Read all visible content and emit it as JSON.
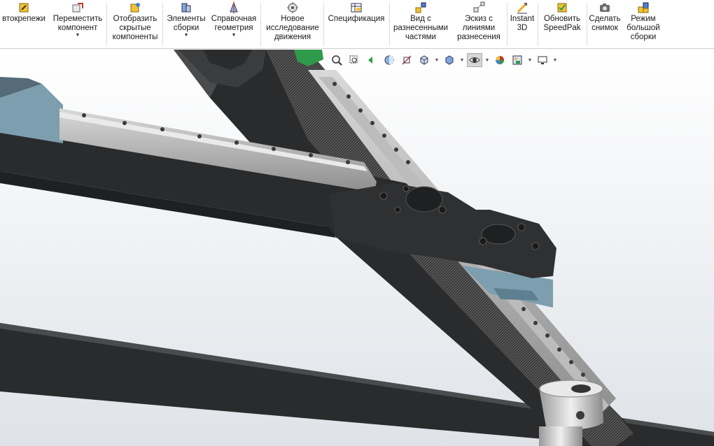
{
  "ribbon": {
    "items": [
      {
        "id": "fasteners",
        "label": "втокрепежи",
        "icon": "fasteners-icon",
        "caret": false
      },
      {
        "id": "move-component",
        "label": "Переместить\nкомпонент",
        "icon": "move-component-icon",
        "caret": true
      },
      {
        "id": "show-hidden",
        "label": "Отобразить\nскрытые\nкомпоненты",
        "icon": "show-hidden-components-icon",
        "caret": false
      },
      {
        "id": "assembly-features",
        "label": "Элементы\nсборки",
        "icon": "assembly-features-icon",
        "caret": true
      },
      {
        "id": "reference-geometry",
        "label": "Справочная\nгеометрия",
        "icon": "reference-geometry-icon",
        "caret": true
      },
      {
        "id": "new-motion-study",
        "label": "Новое\nисследование\nдвижения",
        "icon": "motion-study-icon",
        "caret": false
      },
      {
        "id": "bom",
        "label": "Спецификация",
        "icon": "bill-of-materials-icon",
        "caret": false
      },
      {
        "id": "exploded-view",
        "label": "Вид с\nразнесенными\nчастями",
        "icon": "exploded-view-icon",
        "caret": false
      },
      {
        "id": "explode-line-sketch",
        "label": "Эскиз с\nлиниями\nразнесения",
        "icon": "explode-line-sketch-icon",
        "caret": false
      },
      {
        "id": "instant3d",
        "label": "Instant\n3D",
        "icon": "instant3d-icon",
        "caret": false
      },
      {
        "id": "update-speedpak",
        "label": "Обновить\nSpeedPak",
        "icon": "speedpak-icon",
        "caret": false
      },
      {
        "id": "take-snapshot",
        "label": "Сделать\nснимок",
        "icon": "camera-icon",
        "caret": false
      },
      {
        "id": "large-assembly",
        "label": "Режим\nбольшой\nсборки",
        "icon": "large-assembly-mode-icon",
        "caret": false
      }
    ]
  },
  "heads_up_toolbar": {
    "items": [
      {
        "id": "zoom-to-fit",
        "icon": "zoom-to-fit-icon"
      },
      {
        "id": "zoom-area",
        "icon": "zoom-to-area-icon"
      },
      {
        "id": "previous-view",
        "icon": "previous-view-icon"
      },
      {
        "id": "section-view",
        "icon": "section-view-icon"
      },
      {
        "id": "dynamic-annotation",
        "icon": "dynamic-annotation-views-icon"
      },
      {
        "id": "view-orientation",
        "icon": "view-orientation-icon",
        "caret": true
      },
      {
        "id": "display-style",
        "icon": "display-style-icon",
        "caret": true
      },
      {
        "id": "hide-show-items",
        "icon": "hide-show-items-icon",
        "caret": true,
        "active": true
      },
      {
        "id": "edit-appearance",
        "icon": "edit-appearance-icon"
      },
      {
        "id": "apply-scene",
        "icon": "apply-scene-icon",
        "caret": true
      },
      {
        "id": "view-settings",
        "icon": "view-settings-icon",
        "caret": true
      }
    ]
  },
  "colors": {
    "frame": "#2a2b2d",
    "frame_top": "#565759",
    "rail_light": "#cfcfcf",
    "rail_dark": "#8e8e8e",
    "carriage_blue": "#7d9eae",
    "belt": "#3a3a3a",
    "background_top": "#ffffff",
    "background_bottom": "#dfe3e8",
    "accent_green": "#2f9a4a"
  }
}
